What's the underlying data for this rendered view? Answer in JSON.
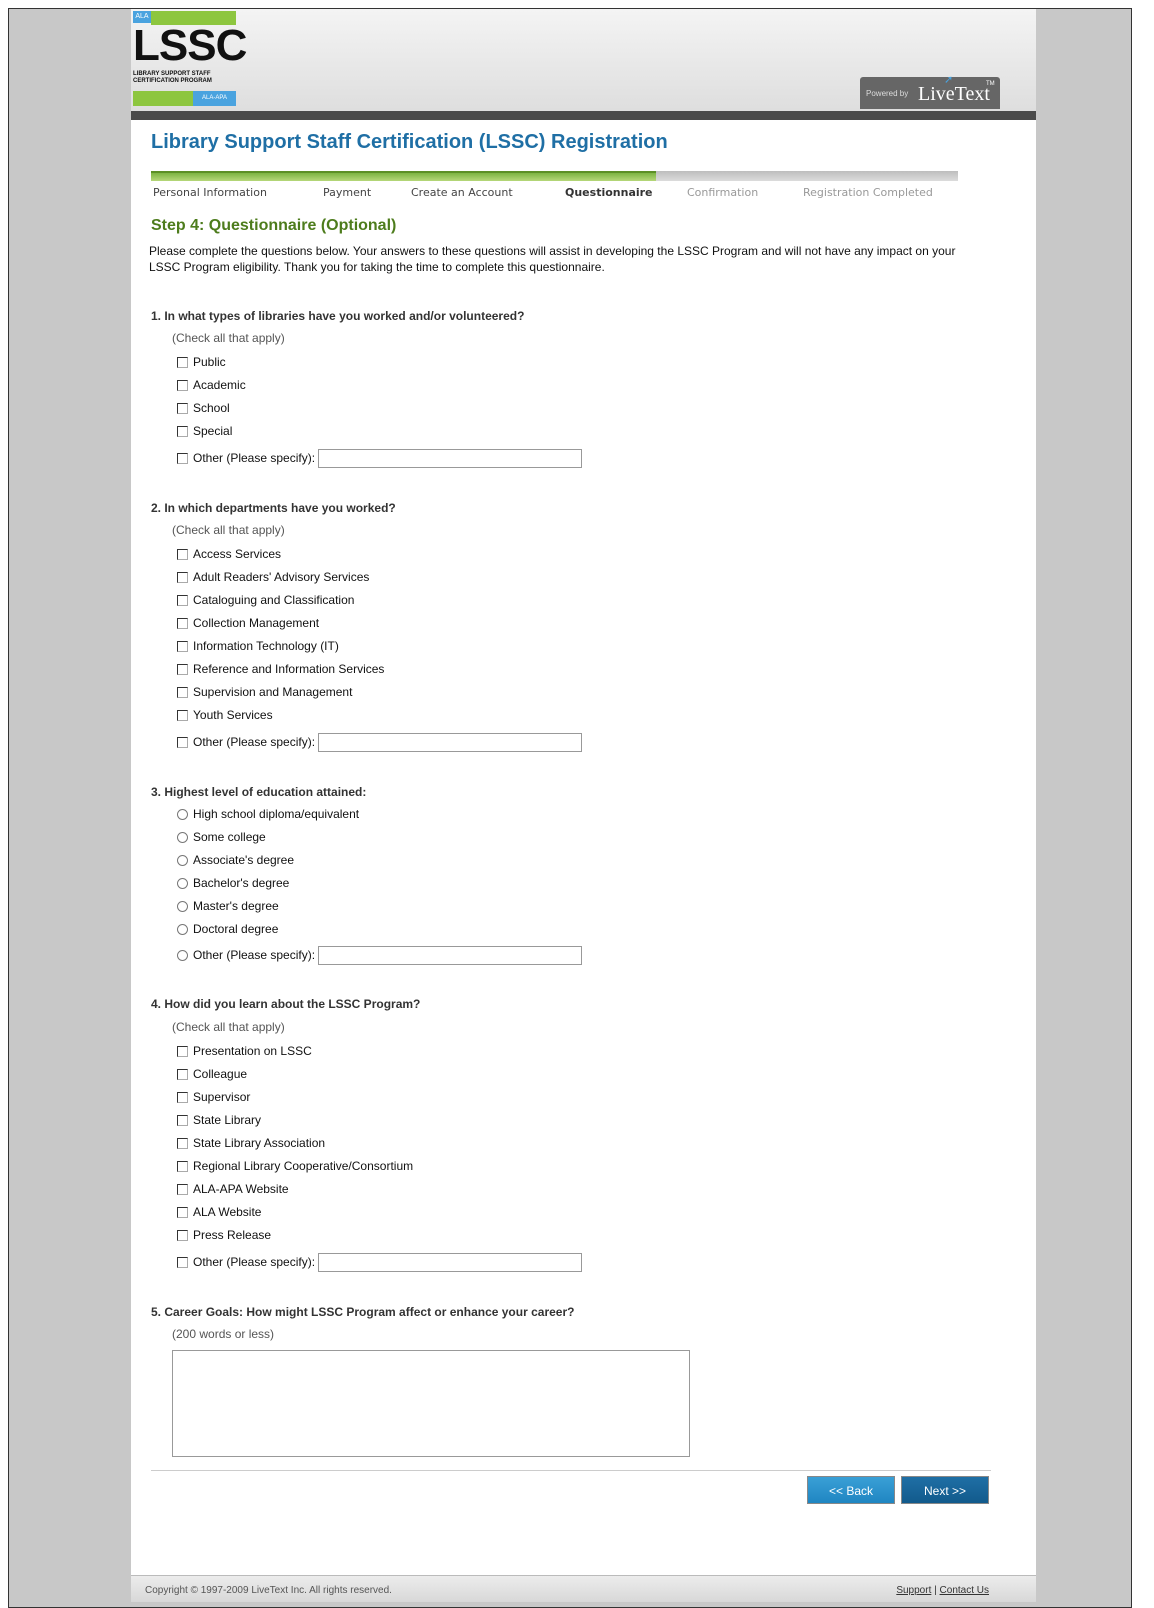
{
  "header": {
    "logo": {
      "ala_tag": "ALA",
      "title": "LSSC",
      "subtitle_line1": "LIBRARY SUPPORT STAFF",
      "subtitle_line2": "CERTIFICATION PROGRAM",
      "bottom_tag": "ALA-APA"
    },
    "powered_by": {
      "prefix": "Powered by",
      "brand": "LiveText",
      "tm": "TM"
    }
  },
  "page_title": "Library Support Staff Certification (LSSC) Registration",
  "steps": [
    {
      "label": "Personal Information",
      "state": "done"
    },
    {
      "label": "Payment",
      "state": "done"
    },
    {
      "label": "Create an Account",
      "state": "done"
    },
    {
      "label": "Questionnaire",
      "state": "current"
    },
    {
      "label": "Confirmation",
      "state": "pending"
    },
    {
      "label": "Registration Completed",
      "state": "pending"
    }
  ],
  "step_heading": "Step 4: Questionnaire (Optional)",
  "intro": "Please complete the questions below. Your answers to these questions will assist in developing the LSSC Program and will not have any impact on your LSSC Program eligibility. Thank you for taking the time to complete this questionnaire.",
  "q1": {
    "title": "1.  In what types of libraries have you worked and/or volunteered?",
    "hint": "(Check all that apply)",
    "options": [
      "Public",
      "Academic",
      "School",
      "Special"
    ],
    "other": "Other (Please specify):"
  },
  "q2": {
    "title": "2.  In which departments have you worked?",
    "hint": "(Check all that apply)",
    "options": [
      "Access Services",
      "Adult Readers' Advisory Services",
      "Cataloguing and Classification",
      "Collection Management",
      "Information Technology (IT)",
      "Reference and Information Services",
      "Supervision and Management",
      "Youth Services"
    ],
    "other": "Other (Please specify):"
  },
  "q3": {
    "title": "3.  Highest level of education attained:",
    "options": [
      "High school diploma/equivalent",
      "Some college",
      "Associate's degree",
      "Bachelor's degree",
      "Master's degree",
      "Doctoral degree"
    ],
    "other": "Other (Please specify):"
  },
  "q4": {
    "title": "4.  How did you learn about the LSSC Program?",
    "hint": "(Check all that apply)",
    "options": [
      "Presentation on LSSC",
      "Colleague",
      "Supervisor",
      "State Library",
      "State Library Association",
      "Regional Library Cooperative/Consortium",
      "ALA-APA Website",
      "ALA Website",
      "Press Release"
    ],
    "other": "Other (Please specify):"
  },
  "q5": {
    "title": "5.  Career Goals: How might LSSC Program affect or enhance your career?",
    "hint": "(200 words or less)",
    "value": ""
  },
  "buttons": {
    "back": "<< Back",
    "next": "Next >>"
  },
  "footer": {
    "copyright": "Copyright © 1997-2009 LiveText Inc. All rights reserved.",
    "support": "Support",
    "separator": "|",
    "contact": "Contact Us"
  }
}
